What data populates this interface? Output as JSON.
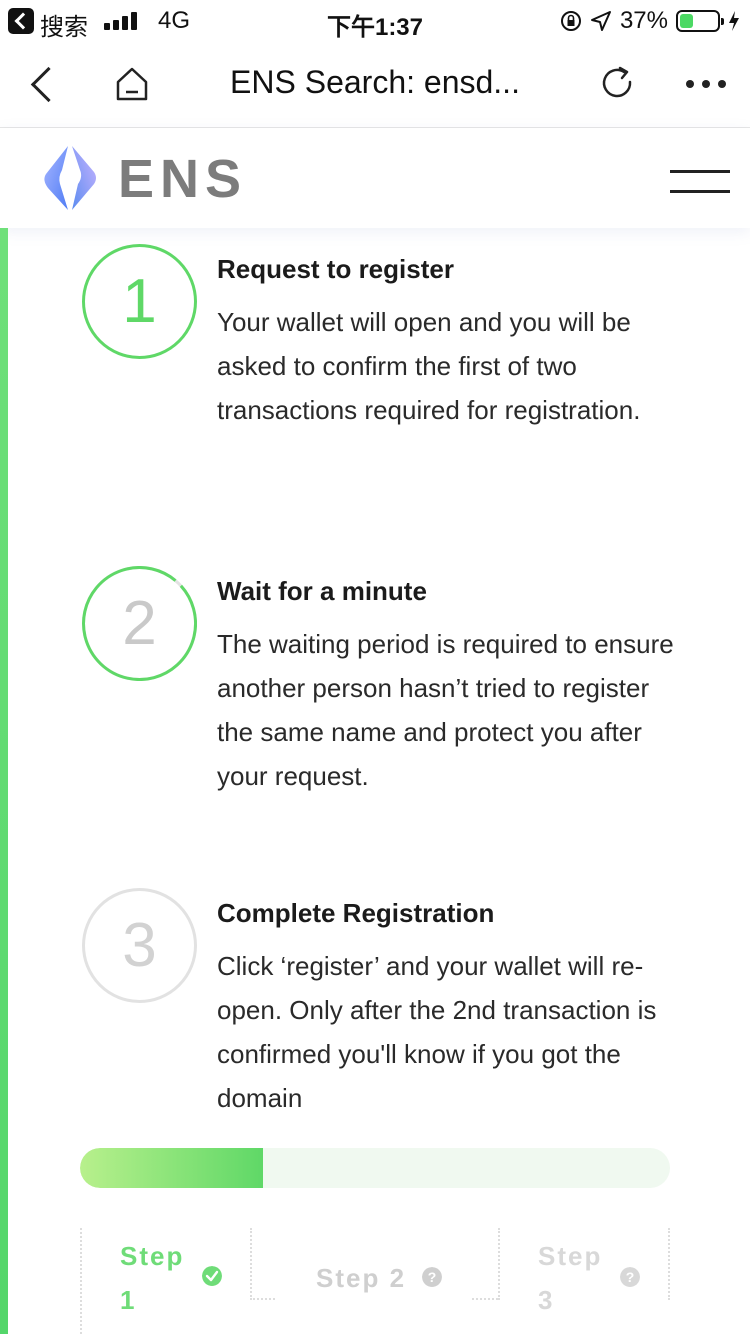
{
  "status_bar": {
    "carrier": "搜索",
    "network": "4G",
    "time": "下午1:37",
    "battery_percent": "37%",
    "battery_level": 0.37
  },
  "navbar": {
    "title": "ENS Search: ensd..."
  },
  "site_header": {
    "logo_text": "ENS"
  },
  "steps": [
    {
      "number": "1",
      "title": "Request to register",
      "description": "Your wallet will open and you will be asked to confirm the first of two transactions required for registration."
    },
    {
      "number": "2",
      "title": "Wait for a minute",
      "description": "The waiting period is required to ensure another person hasn’t tried to register the same name and protect you after your request."
    },
    {
      "number": "3",
      "title": "Complete Registration",
      "description": "Click ‘register’ and your wallet will re-open. Only after the 2nd transaction is confirmed you'll know if you got the domain"
    }
  ],
  "progress": {
    "fraction": 0.31
  },
  "tabs": [
    {
      "label": "Step 1",
      "line1": "Step",
      "line2": "1"
    },
    {
      "label": "Step 2"
    },
    {
      "label": "Step 3",
      "line1": "Step",
      "line2": "3"
    }
  ],
  "colors": {
    "accent": "#5fd867",
    "muted": "#c9c9c9"
  }
}
